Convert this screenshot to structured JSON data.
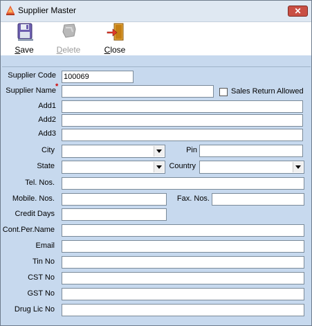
{
  "window": {
    "title": "Supplier Master",
    "close_glyph": "✕"
  },
  "toolbar": {
    "save": {
      "label_underline": "S",
      "label_rest": "ave",
      "icon": "floppy-disk-icon"
    },
    "delete": {
      "label_underline": "D",
      "label_rest": "elete",
      "icon": "eraser-icon",
      "disabled": true
    },
    "close": {
      "label_underline": "C",
      "label_rest": "lose",
      "icon": "exit-door-icon"
    }
  },
  "form": {
    "supplier_code": {
      "label": "Supplier Code",
      "value": "100069"
    },
    "supplier_name": {
      "label": "Supplier Name",
      "required_mark": "*",
      "value": ""
    },
    "sales_return": {
      "label": "Sales Return Allowed",
      "checked": false
    },
    "add1": {
      "label": "Add1",
      "value": ""
    },
    "add2": {
      "label": "Add2",
      "value": ""
    },
    "add3": {
      "label": "Add3",
      "value": ""
    },
    "city": {
      "label": "City",
      "value": ""
    },
    "pin": {
      "label": "Pin",
      "value": ""
    },
    "state": {
      "label": "State",
      "value": ""
    },
    "country": {
      "label": "Country",
      "value": ""
    },
    "tel": {
      "label": "Tel. Nos.",
      "value": ""
    },
    "mobile": {
      "label": "Mobile. Nos.",
      "value": ""
    },
    "fax": {
      "label": "Fax. Nos.",
      "value": ""
    },
    "credit_days": {
      "label": "Credit Days",
      "value": ""
    },
    "contact": {
      "label": "Cont.Per.Name",
      "value": ""
    },
    "email": {
      "label": "Email",
      "value": ""
    },
    "tin": {
      "label": "Tin No",
      "value": ""
    },
    "cst": {
      "label": "CST No",
      "value": ""
    },
    "gst": {
      "label": "GST No",
      "value": ""
    },
    "drug_lic": {
      "label": "Drug Lic No",
      "value": ""
    }
  }
}
